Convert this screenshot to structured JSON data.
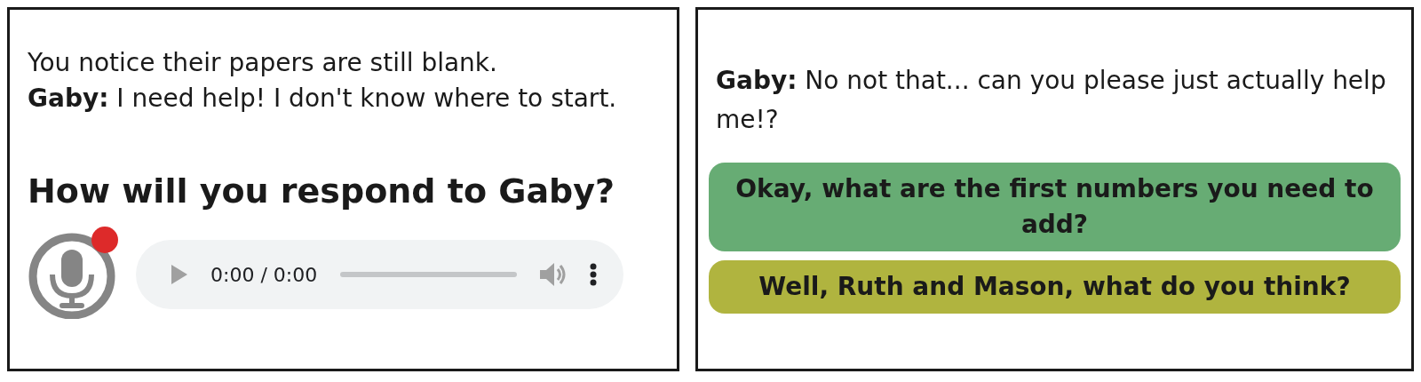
{
  "left_panel": {
    "narration": "You notice their papers are still blank.",
    "dialogue": "**Gaby:** I need help! I don't know where to start.",
    "prompt": "How will you respond to Gaby?",
    "recorder": {
      "recording": true
    },
    "audio_player": {
      "time": "0:00 / 0:00",
      "level": 0
    }
  },
  "right_panel": {
    "dialogue": "**Gaby:** No not that... can you please just actually help me!?",
    "choices": [
      {
        "label": "Okay, what are the first numbers you need to add?",
        "color": "#67ac74"
      },
      {
        "label": "Well, Ruth and Mason, what do you think?",
        "color": "#b0b43f"
      }
    ]
  }
}
